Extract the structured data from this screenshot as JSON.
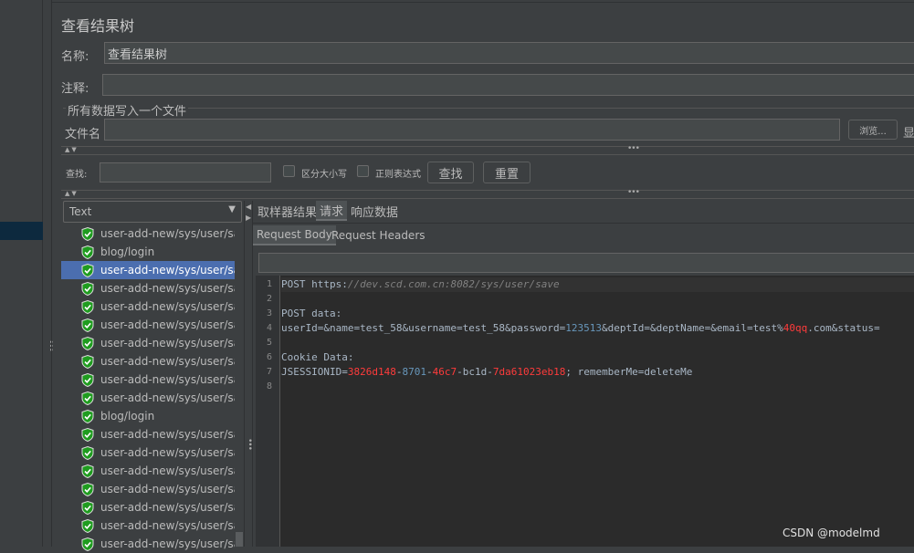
{
  "title": "查看结果树",
  "name_label": "名称:",
  "name_value": "查看结果树",
  "comment_label": "注释:",
  "comment_value": "",
  "file_group_label": "所有数据写入一个文件",
  "filename_label": "文件名",
  "filename_value": "",
  "browse_label": "浏览...",
  "display_label_partial": "显",
  "search": {
    "label": "查找:",
    "value": "",
    "case_sensitive_label": "区分大小写",
    "regex_label": "正则表达式",
    "find_button": "查找",
    "reset_button": "重置"
  },
  "renderer_select": "Text",
  "tree_items": [
    {
      "label": "user-add-new/sys/user/save",
      "status": "success"
    },
    {
      "label": "blog/login",
      "status": "success"
    },
    {
      "label": "user-add-new/sys/user/save",
      "status": "success",
      "selected": true
    },
    {
      "label": "user-add-new/sys/user/save",
      "status": "success"
    },
    {
      "label": "user-add-new/sys/user/save",
      "status": "success"
    },
    {
      "label": "user-add-new/sys/user/save",
      "status": "success"
    },
    {
      "label": "user-add-new/sys/user/save",
      "status": "success"
    },
    {
      "label": "user-add-new/sys/user/save",
      "status": "success"
    },
    {
      "label": "user-add-new/sys/user/save",
      "status": "success"
    },
    {
      "label": "user-add-new/sys/user/save",
      "status": "success"
    },
    {
      "label": "blog/login",
      "status": "success"
    },
    {
      "label": "user-add-new/sys/user/save",
      "status": "success"
    },
    {
      "label": "user-add-new/sys/user/save",
      "status": "success"
    },
    {
      "label": "user-add-new/sys/user/save",
      "status": "success"
    },
    {
      "label": "user-add-new/sys/user/save",
      "status": "success"
    },
    {
      "label": "user-add-new/sys/user/save",
      "status": "success"
    },
    {
      "label": "user-add-new/sys/user/save",
      "status": "success"
    },
    {
      "label": "user-add-new/sys/user/save",
      "status": "success"
    }
  ],
  "tabs": [
    {
      "label": "取样器结果",
      "active": false
    },
    {
      "label": "请求",
      "active": true
    },
    {
      "label": "响应数据",
      "active": false
    }
  ],
  "subtabs": [
    {
      "label": "Request Body",
      "active": true
    },
    {
      "label": "Request Headers",
      "active": false
    }
  ],
  "colors": {
    "plain": "#a9b7c6",
    "url": "#808080",
    "number": "#6897bb",
    "red": "#ff3b3b"
  },
  "code_lines": [
    [
      {
        "t": "POST https:",
        "c": "plain"
      },
      {
        "t": "//dev.scd.com.cn:8082/sys/user/save",
        "c": "url"
      }
    ],
    [],
    [
      {
        "t": "POST data:",
        "c": "plain"
      }
    ],
    [
      {
        "t": "userId=&name=test_58&username=test_58&password=",
        "c": "plain"
      },
      {
        "t": "123513",
        "c": "number"
      },
      {
        "t": "&deptId=&deptName=&email=test%",
        "c": "plain"
      },
      {
        "t": "40qq",
        "c": "red"
      },
      {
        "t": ".com&status=",
        "c": "plain"
      }
    ],
    [],
    [
      {
        "t": "Cookie Data:",
        "c": "plain"
      }
    ],
    [
      {
        "t": "JSESSIONID=",
        "c": "plain"
      },
      {
        "t": "3826d148",
        "c": "red"
      },
      {
        "t": "-",
        "c": "plain"
      },
      {
        "t": "8701",
        "c": "number"
      },
      {
        "t": "-",
        "c": "plain"
      },
      {
        "t": "46c7",
        "c": "red"
      },
      {
        "t": "-bc1d-",
        "c": "plain"
      },
      {
        "t": "7da61023eb18",
        "c": "red"
      },
      {
        "t": "; rememberMe=deleteMe",
        "c": "plain"
      }
    ],
    []
  ],
  "watermark": "CSDN @modelmd"
}
